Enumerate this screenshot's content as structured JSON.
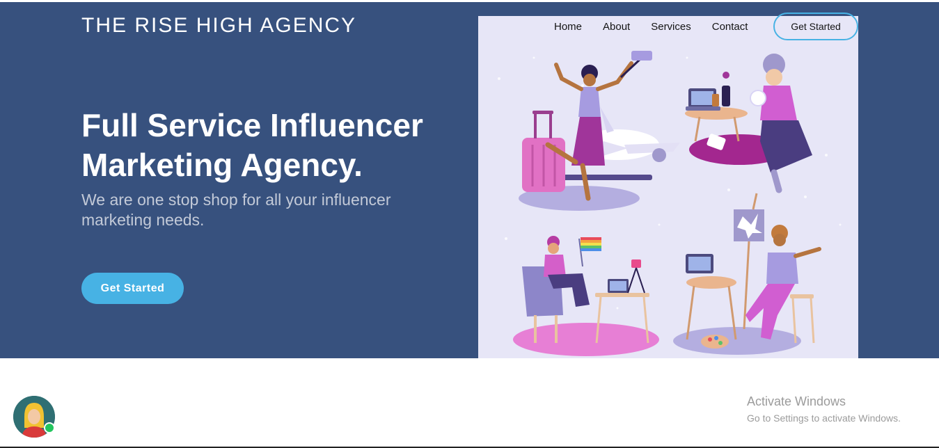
{
  "brand": {
    "name": "THE RISE HIGH AGENCY"
  },
  "nav": {
    "items": [
      "Home",
      "About",
      "Services",
      "Contact"
    ],
    "cta_label": "Get Started"
  },
  "hero": {
    "headline_line1": "Full Service Influencer",
    "headline_line2": "Marketing Agency.",
    "subtitle": "We are one stop shop for all your influencer marketing needs.",
    "cta_label": "Get Started"
  },
  "illustration": {
    "icon": "influencer-lifestyle-illustration"
  },
  "chat_widget": {
    "icon": "support-agent-avatar",
    "status_color": "#22c55e"
  },
  "os_watermark": {
    "title": "Activate Windows",
    "subtitle": "Go to Settings to activate Windows."
  },
  "colors": {
    "hero_bg": "#37517e",
    "accent": "#47b2e4",
    "illustration_bg": "#e7e6f7"
  }
}
